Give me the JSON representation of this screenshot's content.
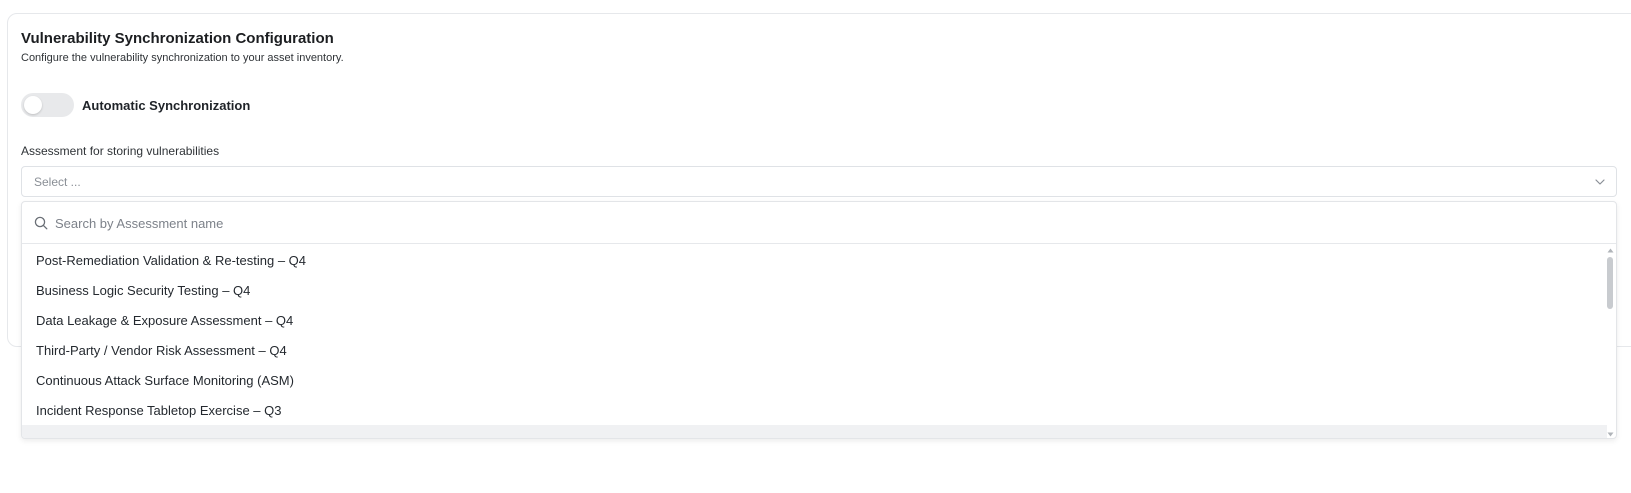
{
  "config": {
    "title": "Vulnerability Synchronization Configuration",
    "subtitle": "Configure the vulnerability synchronization to your asset inventory."
  },
  "auto_sync": {
    "label": "Automatic Synchronization",
    "enabled": false
  },
  "assessment_field": {
    "label": "Assessment for storing vulnerabilities",
    "placeholder": "Select ...",
    "search_placeholder": "Search by Assessment name",
    "options": [
      "Post-Remediation Validation & Re-testing – Q4",
      "Business Logic Security Testing – Q4",
      "Data Leakage & Exposure Assessment – Q4",
      "Third-Party / Vendor Risk Assessment – Q4",
      "Continuous Attack Surface Monitoring (ASM)",
      "Incident Response Tabletop Exercise – Q3"
    ]
  },
  "icons": {
    "search": "search-icon",
    "chevron": "chevron-down-icon",
    "scroll_up": "scroll-up-arrow-icon",
    "scroll_down": "scroll-down-arrow-icon"
  },
  "colors": {
    "toggle_off": "#e8e9eb",
    "border": "#dfe2e6",
    "text": "#1f2328",
    "muted": "#8a8f96"
  }
}
